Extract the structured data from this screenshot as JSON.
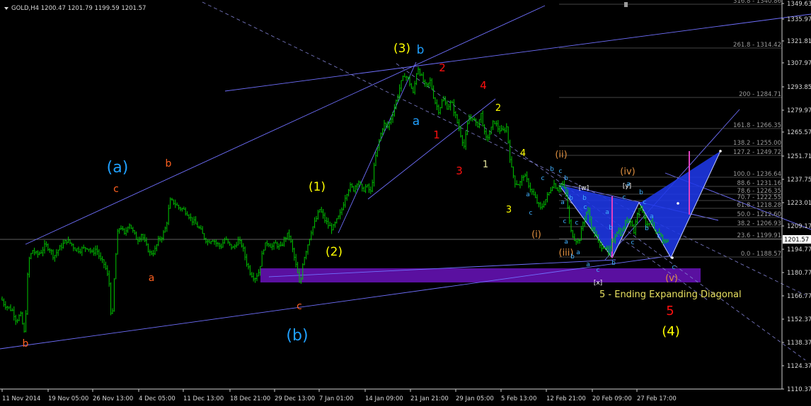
{
  "header": {
    "title": "GOLD,H4  1200.47 1201.79 1199.59 1201.57"
  },
  "chart_data": {
    "type": "candlestick",
    "symbol": "GOLD",
    "timeframe": "H4",
    "ohlc_readout": {
      "open": 1200.47,
      "high": 1201.79,
      "low": 1199.59,
      "close": 1201.57
    },
    "current_price_label": "1201.57",
    "ylim": [
      1110.37,
      1346.0
    ],
    "y_ticks": [
      "1349.63",
      "1335.97",
      "1321.81",
      "1307.97",
      "1293.85",
      "1279.97",
      "1265.57",
      "1251.71",
      "1237.75",
      "1223.01",
      "1209.17",
      "1194.77",
      "1180.77",
      "1166.77",
      "1152.37",
      "1138.37",
      "1124.37",
      "1110.37"
    ],
    "x_ticks": [
      "11 Nov 2014",
      "19 Nov 05:00",
      "26 Nov 13:00",
      "4 Dec 05:00",
      "11 Dec 13:00",
      "18 Dec 21:00",
      "29 Dec 13:00",
      "7 Jan 01:00",
      "14 Jan 09:00",
      "21 Jan 21:00",
      "29 Jan 05:00",
      "5 Feb 13:00",
      "12 Feb 21:00",
      "20 Feb 09:00",
      "27 Feb 17:00"
    ],
    "price_path": [
      [
        0,
        1167
      ],
      [
        6,
        1162
      ],
      [
        12,
        1160
      ],
      [
        18,
        1158
      ],
      [
        23,
        1152
      ],
      [
        29,
        1156
      ],
      [
        35,
        1143
      ],
      [
        40,
        1188
      ],
      [
        46,
        1195
      ],
      [
        52,
        1192
      ],
      [
        58,
        1194
      ],
      [
        64,
        1198
      ],
      [
        70,
        1196
      ],
      [
        76,
        1191
      ],
      [
        82,
        1195
      ],
      [
        88,
        1198
      ],
      [
        94,
        1201
      ],
      [
        100,
        1199
      ],
      [
        106,
        1196
      ],
      [
        112,
        1195
      ],
      [
        118,
        1196
      ],
      [
        124,
        1197
      ],
      [
        130,
        1193
      ],
      [
        136,
        1196
      ],
      [
        142,
        1189
      ],
      [
        148,
        1186
      ],
      [
        154,
        1176
      ],
      [
        158,
        1148
      ],
      [
        162,
        1182
      ],
      [
        166,
        1205
      ],
      [
        170,
        1210
      ],
      [
        176,
        1204
      ],
      [
        182,
        1212
      ],
      [
        188,
        1206
      ],
      [
        194,
        1201
      ],
      [
        200,
        1205
      ],
      [
        206,
        1198
      ],
      [
        212,
        1193
      ],
      [
        218,
        1194
      ],
      [
        224,
        1201
      ],
      [
        230,
        1204
      ],
      [
        235,
        1210
      ],
      [
        240,
        1225
      ],
      [
        246,
        1224
      ],
      [
        252,
        1221
      ],
      [
        258,
        1220
      ],
      [
        264,
        1218
      ],
      [
        270,
        1214
      ],
      [
        276,
        1211
      ],
      [
        282,
        1208
      ],
      [
        288,
        1203
      ],
      [
        294,
        1200
      ],
      [
        300,
        1202
      ],
      [
        306,
        1199
      ],
      [
        312,
        1197
      ],
      [
        318,
        1202
      ],
      [
        324,
        1198
      ],
      [
        330,
        1196
      ],
      [
        336,
        1201
      ],
      [
        342,
        1198
      ],
      [
        348,
        1188
      ],
      [
        354,
        1181
      ],
      [
        360,
        1178
      ],
      [
        366,
        1182
      ],
      [
        372,
        1196
      ],
      [
        378,
        1200
      ],
      [
        384,
        1197
      ],
      [
        390,
        1199
      ],
      [
        396,
        1196
      ],
      [
        402,
        1202
      ],
      [
        408,
        1205
      ],
      [
        414,
        1194
      ],
      [
        420,
        1182
      ],
      [
        424,
        1172
      ],
      [
        428,
        1188
      ],
      [
        434,
        1197
      ],
      [
        440,
        1207
      ],
      [
        446,
        1213
      ],
      [
        452,
        1220
      ],
      [
        458,
        1214
      ],
      [
        464,
        1210
      ],
      [
        470,
        1208
      ],
      [
        476,
        1213
      ],
      [
        482,
        1218
      ],
      [
        488,
        1228
      ],
      [
        494,
        1234
      ],
      [
        500,
        1232
      ],
      [
        506,
        1238
      ],
      [
        512,
        1231
      ],
      [
        518,
        1234
      ],
      [
        524,
        1230
      ],
      [
        530,
        1250
      ],
      [
        536,
        1262
      ],
      [
        542,
        1272
      ],
      [
        548,
        1270
      ],
      [
        554,
        1277
      ],
      [
        560,
        1286
      ],
      [
        566,
        1296
      ],
      [
        572,
        1302
      ],
      [
        578,
        1298
      ],
      [
        584,
        1290
      ],
      [
        590,
        1307
      ],
      [
        596,
        1300
      ],
      [
        602,
        1294
      ],
      [
        608,
        1298
      ],
      [
        614,
        1286
      ],
      [
        620,
        1280
      ],
      [
        626,
        1287
      ],
      [
        632,
        1282
      ],
      [
        638,
        1285
      ],
      [
        644,
        1276
      ],
      [
        650,
        1267
      ],
      [
        656,
        1258
      ],
      [
        662,
        1275
      ],
      [
        668,
        1276
      ],
      [
        674,
        1270
      ],
      [
        680,
        1278
      ],
      [
        686,
        1262
      ],
      [
        692,
        1266
      ],
      [
        698,
        1274
      ],
      [
        704,
        1269
      ],
      [
        710,
        1267
      ],
      [
        716,
        1270
      ],
      [
        722,
        1246
      ],
      [
        728,
        1236
      ],
      [
        734,
        1235
      ],
      [
        740,
        1241
      ],
      [
        746,
        1236
      ],
      [
        752,
        1230
      ],
      [
        758,
        1225
      ],
      [
        764,
        1220
      ],
      [
        770,
        1225
      ],
      [
        776,
        1230
      ],
      [
        782,
        1236
      ],
      [
        788,
        1232
      ],
      [
        794,
        1236
      ],
      [
        800,
        1229
      ],
      [
        806,
        1207
      ],
      [
        812,
        1202
      ],
      [
        818,
        1200
      ],
      [
        824,
        1212
      ],
      [
        830,
        1220
      ],
      [
        836,
        1209
      ],
      [
        842,
        1204
      ],
      [
        848,
        1197
      ],
      [
        854,
        1198
      ],
      [
        860,
        1192
      ],
      [
        866,
        1201
      ],
      [
        872,
        1207
      ],
      [
        878,
        1205
      ],
      [
        884,
        1212
      ],
      [
        890,
        1215
      ],
      [
        896,
        1206
      ],
      [
        902,
        1222
      ],
      [
        908,
        1219
      ],
      [
        914,
        1209
      ],
      [
        920,
        1212
      ],
      [
        926,
        1204
      ],
      [
        932,
        1206
      ],
      [
        938,
        1200
      ],
      [
        944,
        1201
      ]
    ],
    "fibonacci_levels": [
      "316.8 - 1340.86",
      "261.8 - 1314.42",
      "200 - 1284.71",
      "161.8 - 1266.35",
      "138.2 - 1255.00",
      "127.2 - 1249.72",
      "100.0 - 1236.64",
      "88.6 - 1231.16",
      "78.6 - 1226.35",
      "70.7 - 1222.55",
      "61.8 - 1218.28",
      "50.0 - 1212.60",
      "38.2 - 1206.93",
      "23.6 - 1199.91",
      "0.0 - 1188.57"
    ],
    "wave_labels": {
      "major_a": "(a)",
      "major_b": "(b)",
      "minor_c_top": "c",
      "minor_b_top": "b",
      "minor_a": "a",
      "minor_b_bottom": "b",
      "minor_c_bottom": "c",
      "w1": "(1)",
      "w2": "(2)",
      "w3": "(3)",
      "w3_b": "b",
      "w3_a": "a",
      "red_1": "1",
      "red_2": "2",
      "red_3": "3",
      "red_4": "4",
      "red_5": "5",
      "small_2": "2",
      "small_1": "1",
      "small_3": "3",
      "small_4": "4",
      "sub_i": "(i)",
      "sub_ii": "(ii)",
      "sub_iii": "(iii)",
      "sub_iv": "(iv)",
      "sub_v": "(v)",
      "w_bracket": "[w]",
      "y_bracket": "[y]",
      "x_bracket": "[x]",
      "w4": "(4)",
      "diag_labels": [
        "c",
        "b",
        "a",
        "b",
        "c",
        "a",
        "b",
        "c",
        "a",
        "c",
        "b",
        "a",
        "b",
        "c",
        "a",
        "b",
        "c",
        "a",
        "b",
        "c",
        "b",
        "a",
        "c",
        "b",
        "c",
        "a",
        "c"
      ]
    },
    "annotation": "5 - Ending Expanding Diagonal",
    "colors": {
      "background": "#000000",
      "candles": "#00c800",
      "trendlines": "#7070ff",
      "channel_dashed": "#8080d0",
      "zone": "#5a10a0",
      "pattern_fill": "#1e38e8",
      "pattern_marker": "#e040c0",
      "yellow_labels": "#ffff00",
      "red_labels": "#ff1010",
      "orange_labels": "#ff6020",
      "cyan_labels": "#20a0ff",
      "light_orange": "#e09040",
      "fib_text": "#9a9a9a"
    }
  }
}
